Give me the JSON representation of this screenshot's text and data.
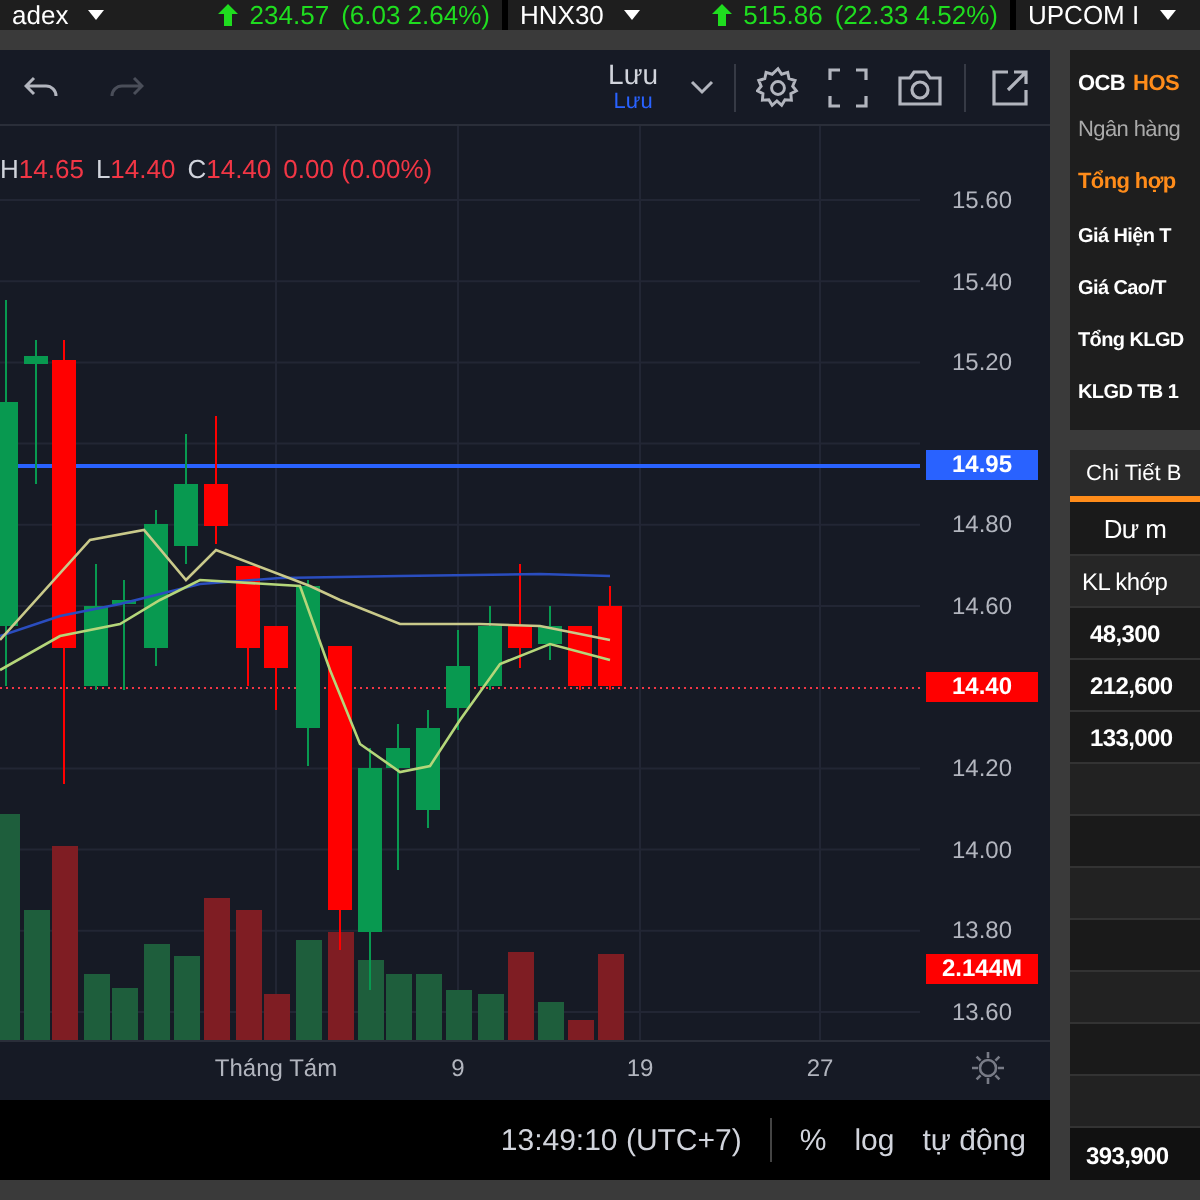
{
  "ticker": [
    {
      "kind": "index",
      "label": "adex"
    },
    {
      "kind": "quote",
      "value": "234.57",
      "change": "(6.03 2.64%)"
    },
    {
      "kind": "index",
      "label": "HNX30"
    },
    {
      "kind": "quote",
      "value": "515.86",
      "change": "(22.33 4.52%)"
    },
    {
      "kind": "index",
      "label": "UPCOM I"
    }
  ],
  "toolbar": {
    "undo_disabled": false,
    "redo_disabled": true,
    "save_label": "Lưu",
    "save_sublabel": "Lưu"
  },
  "legend": [
    {
      "key": "H",
      "value": "14.65"
    },
    {
      "key": "L",
      "value": "14.40"
    },
    {
      "key": "C",
      "value": "14.40"
    }
  ],
  "legend_change": "0.00 (0.00%)",
  "price_axis": {
    "ticks": [
      "15.60",
      "15.40",
      "15.20",
      "14.80",
      "14.60",
      "14.20",
      "14.00",
      "13.80",
      "13.60"
    ],
    "badges": [
      {
        "kind": "line",
        "label": "14.95",
        "color": "#2962ff"
      },
      {
        "kind": "last",
        "label": "14.40",
        "color": "#ff0000"
      },
      {
        "kind": "volume",
        "label": "2.144M",
        "color": "#ff0000"
      }
    ]
  },
  "time_axis": [
    "Tháng Tám",
    "9",
    "19",
    "27"
  ],
  "bottom_bar": {
    "time": "13:49:10 (UTC+7)",
    "options": [
      "%",
      "log",
      "tự động"
    ]
  },
  "side_panel": {
    "symbol": "OCB",
    "exchange": "HOS",
    "name": "Ngân hàng",
    "section": "Tổng hợp",
    "fields": [
      "Giá Hiện T",
      "Giá Cao/T",
      "Tổng KLGD",
      "KLGD TB 1"
    ],
    "tab": {
      "label": "Chi Tiết B",
      "selected": true
    },
    "table": {
      "group_header": "Dư m",
      "column": "KL khớp",
      "rows": [
        "48,300",
        "212,600",
        "133,000"
      ],
      "footer": "393,900"
    }
  }
}
